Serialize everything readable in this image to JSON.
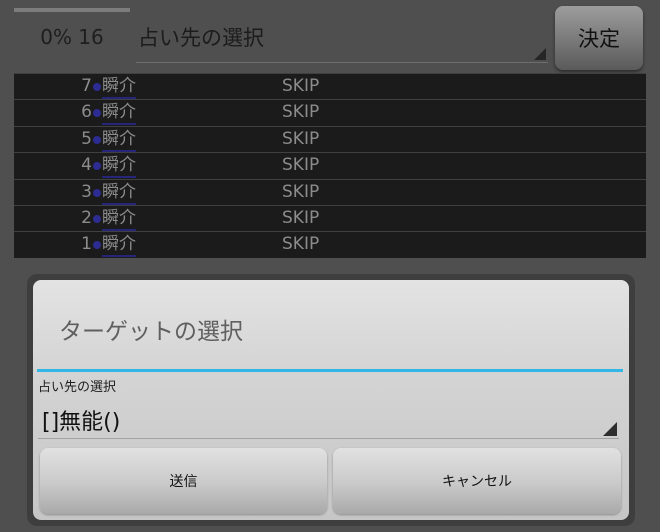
{
  "top": {
    "progress_percent": 0,
    "progress_label": "0% 16",
    "target_select_label": "占い先の選択",
    "decide_label": "決定"
  },
  "votes": [
    {
      "num": "7",
      "name": "瞬介",
      "action": "SKIP"
    },
    {
      "num": "6",
      "name": "瞬介",
      "action": "SKIP"
    },
    {
      "num": "5",
      "name": "瞬介",
      "action": "SKIP"
    },
    {
      "num": "4",
      "name": "瞬介",
      "action": "SKIP"
    },
    {
      "num": "3",
      "name": "瞬介",
      "action": "SKIP"
    },
    {
      "num": "2",
      "name": "瞬介",
      "action": "SKIP"
    },
    {
      "num": "1",
      "name": "瞬介",
      "action": "SKIP"
    }
  ],
  "dialog": {
    "title": "ターゲットの選択",
    "field_label": "占い先の選択",
    "selected_value": "[]無能()",
    "send_label": "送信",
    "cancel_label": "キャンセル"
  },
  "colors": {
    "accent_divider": "#33b5e5",
    "list_background": "#1b1b1b",
    "name_dot": "#2c2c92"
  },
  "icons": {
    "select_arrow": "dropdown-corner-triangle-icon",
    "name_dot": "player-dot-icon"
  }
}
